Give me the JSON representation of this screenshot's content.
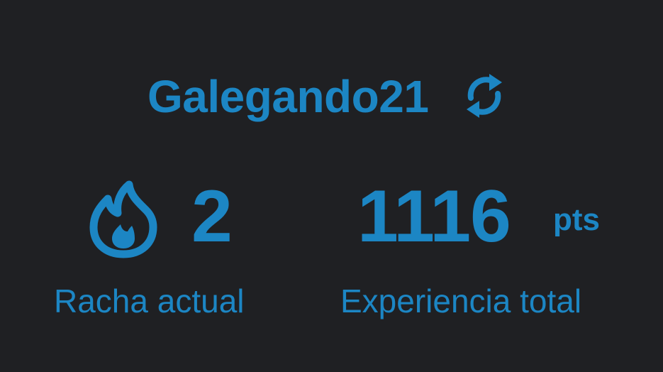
{
  "profile": {
    "username": "Galegando21",
    "refresh_icon": "refresh-icon"
  },
  "stats": {
    "streak": {
      "icon": "flame-icon",
      "value": "2",
      "label": "Racha actual"
    },
    "experience": {
      "value": "1116",
      "unit": "pts",
      "label": "Experiencia total"
    }
  },
  "colors": {
    "background": "#1f2023",
    "accent": "#1c86c4"
  }
}
